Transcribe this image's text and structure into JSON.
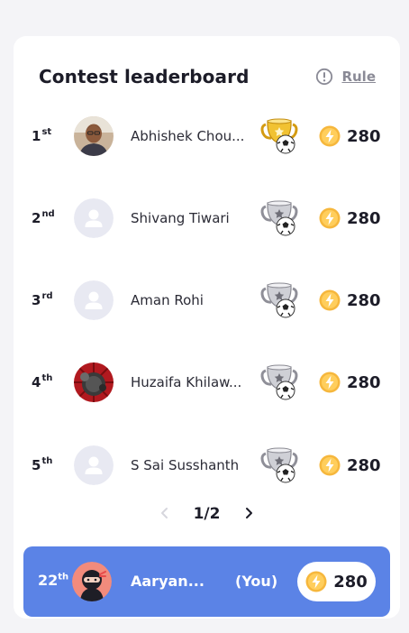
{
  "header": {
    "title": "Contest leaderboard",
    "rule_label": "Rule"
  },
  "rows": [
    {
      "rank": "1",
      "suffix": "st",
      "name": "Abhishek Chou...",
      "score": "280",
      "trophy": "gold-trophy-icon",
      "avatar": "photo"
    },
    {
      "rank": "2",
      "suffix": "nd",
      "name": "Shivang Tiwari",
      "score": "280",
      "trophy": "silver-trophy-icon",
      "avatar": "placeholder"
    },
    {
      "rank": "3",
      "suffix": "rd",
      "name": "Aman Rohi",
      "score": "280",
      "trophy": "silver-trophy-icon",
      "avatar": "placeholder"
    },
    {
      "rank": "4",
      "suffix": "th",
      "name": "Huzaifa Khilaw...",
      "score": "280",
      "trophy": "silver-trophy-icon",
      "avatar": "photo"
    },
    {
      "rank": "5",
      "suffix": "th",
      "name": "S Sai Susshanth",
      "score": "280",
      "trophy": "silver-trophy-icon",
      "avatar": "placeholder"
    }
  ],
  "pagination": {
    "text": "1/2"
  },
  "current_user": {
    "rank": "22",
    "suffix": "th",
    "name": "Aaryan...",
    "tag": "(You)",
    "score": "280"
  },
  "colors": {
    "accent": "#5b83e6",
    "bolt": "#f6b73c",
    "gold": "#e6b21f",
    "silver": "#9a9aa2"
  }
}
